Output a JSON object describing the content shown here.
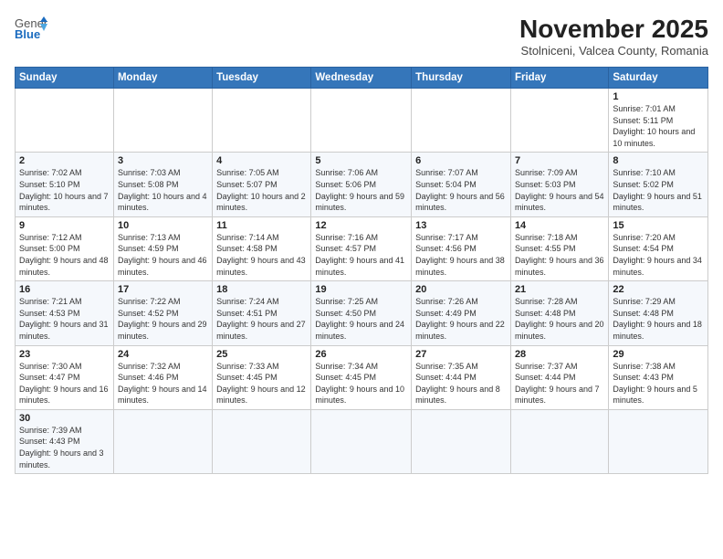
{
  "header": {
    "logo_general": "General",
    "logo_blue": "Blue",
    "month_title": "November 2025",
    "location": "Stolniceni, Valcea County, Romania"
  },
  "days_of_week": [
    "Sunday",
    "Monday",
    "Tuesday",
    "Wednesday",
    "Thursday",
    "Friday",
    "Saturday"
  ],
  "weeks": [
    [
      {
        "day": "",
        "info": ""
      },
      {
        "day": "",
        "info": ""
      },
      {
        "day": "",
        "info": ""
      },
      {
        "day": "",
        "info": ""
      },
      {
        "day": "",
        "info": ""
      },
      {
        "day": "",
        "info": ""
      },
      {
        "day": "1",
        "info": "Sunrise: 7:01 AM\nSunset: 5:11 PM\nDaylight: 10 hours and 10 minutes."
      }
    ],
    [
      {
        "day": "2",
        "info": "Sunrise: 7:02 AM\nSunset: 5:10 PM\nDaylight: 10 hours and 7 minutes."
      },
      {
        "day": "3",
        "info": "Sunrise: 7:03 AM\nSunset: 5:08 PM\nDaylight: 10 hours and 4 minutes."
      },
      {
        "day": "4",
        "info": "Sunrise: 7:05 AM\nSunset: 5:07 PM\nDaylight: 10 hours and 2 minutes."
      },
      {
        "day": "5",
        "info": "Sunrise: 7:06 AM\nSunset: 5:06 PM\nDaylight: 9 hours and 59 minutes."
      },
      {
        "day": "6",
        "info": "Sunrise: 7:07 AM\nSunset: 5:04 PM\nDaylight: 9 hours and 56 minutes."
      },
      {
        "day": "7",
        "info": "Sunrise: 7:09 AM\nSunset: 5:03 PM\nDaylight: 9 hours and 54 minutes."
      },
      {
        "day": "8",
        "info": "Sunrise: 7:10 AM\nSunset: 5:02 PM\nDaylight: 9 hours and 51 minutes."
      }
    ],
    [
      {
        "day": "9",
        "info": "Sunrise: 7:12 AM\nSunset: 5:00 PM\nDaylight: 9 hours and 48 minutes."
      },
      {
        "day": "10",
        "info": "Sunrise: 7:13 AM\nSunset: 4:59 PM\nDaylight: 9 hours and 46 minutes."
      },
      {
        "day": "11",
        "info": "Sunrise: 7:14 AM\nSunset: 4:58 PM\nDaylight: 9 hours and 43 minutes."
      },
      {
        "day": "12",
        "info": "Sunrise: 7:16 AM\nSunset: 4:57 PM\nDaylight: 9 hours and 41 minutes."
      },
      {
        "day": "13",
        "info": "Sunrise: 7:17 AM\nSunset: 4:56 PM\nDaylight: 9 hours and 38 minutes."
      },
      {
        "day": "14",
        "info": "Sunrise: 7:18 AM\nSunset: 4:55 PM\nDaylight: 9 hours and 36 minutes."
      },
      {
        "day": "15",
        "info": "Sunrise: 7:20 AM\nSunset: 4:54 PM\nDaylight: 9 hours and 34 minutes."
      }
    ],
    [
      {
        "day": "16",
        "info": "Sunrise: 7:21 AM\nSunset: 4:53 PM\nDaylight: 9 hours and 31 minutes."
      },
      {
        "day": "17",
        "info": "Sunrise: 7:22 AM\nSunset: 4:52 PM\nDaylight: 9 hours and 29 minutes."
      },
      {
        "day": "18",
        "info": "Sunrise: 7:24 AM\nSunset: 4:51 PM\nDaylight: 9 hours and 27 minutes."
      },
      {
        "day": "19",
        "info": "Sunrise: 7:25 AM\nSunset: 4:50 PM\nDaylight: 9 hours and 24 minutes."
      },
      {
        "day": "20",
        "info": "Sunrise: 7:26 AM\nSunset: 4:49 PM\nDaylight: 9 hours and 22 minutes."
      },
      {
        "day": "21",
        "info": "Sunrise: 7:28 AM\nSunset: 4:48 PM\nDaylight: 9 hours and 20 minutes."
      },
      {
        "day": "22",
        "info": "Sunrise: 7:29 AM\nSunset: 4:48 PM\nDaylight: 9 hours and 18 minutes."
      }
    ],
    [
      {
        "day": "23",
        "info": "Sunrise: 7:30 AM\nSunset: 4:47 PM\nDaylight: 9 hours and 16 minutes."
      },
      {
        "day": "24",
        "info": "Sunrise: 7:32 AM\nSunset: 4:46 PM\nDaylight: 9 hours and 14 minutes."
      },
      {
        "day": "25",
        "info": "Sunrise: 7:33 AM\nSunset: 4:45 PM\nDaylight: 9 hours and 12 minutes."
      },
      {
        "day": "26",
        "info": "Sunrise: 7:34 AM\nSunset: 4:45 PM\nDaylight: 9 hours and 10 minutes."
      },
      {
        "day": "27",
        "info": "Sunrise: 7:35 AM\nSunset: 4:44 PM\nDaylight: 9 hours and 8 minutes."
      },
      {
        "day": "28",
        "info": "Sunrise: 7:37 AM\nSunset: 4:44 PM\nDaylight: 9 hours and 7 minutes."
      },
      {
        "day": "29",
        "info": "Sunrise: 7:38 AM\nSunset: 4:43 PM\nDaylight: 9 hours and 5 minutes."
      }
    ],
    [
      {
        "day": "30",
        "info": "Sunrise: 7:39 AM\nSunset: 4:43 PM\nDaylight: 9 hours and 3 minutes."
      },
      {
        "day": "",
        "info": ""
      },
      {
        "day": "",
        "info": ""
      },
      {
        "day": "",
        "info": ""
      },
      {
        "day": "",
        "info": ""
      },
      {
        "day": "",
        "info": ""
      },
      {
        "day": "",
        "info": ""
      }
    ]
  ]
}
